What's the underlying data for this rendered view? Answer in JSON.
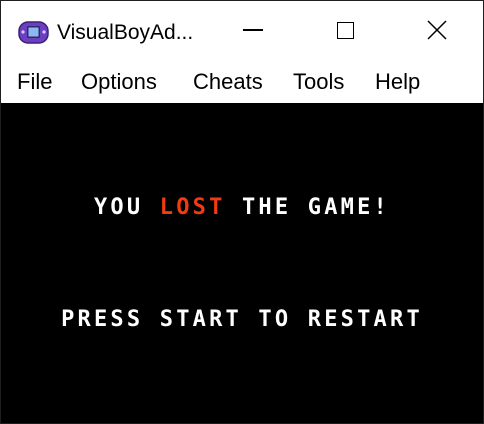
{
  "window": {
    "title": "VisualBoyAd...",
    "icon": "gameboy-advance-icon",
    "controls": {
      "minimize": "minimize-icon",
      "maximize": "maximize-icon",
      "close": "close-icon"
    }
  },
  "menu": {
    "items": [
      {
        "label": "File"
      },
      {
        "label": "Options"
      },
      {
        "label": "Cheats"
      },
      {
        "label": "Tools"
      },
      {
        "label": "Help"
      }
    ]
  },
  "game": {
    "message_prefix": "YOU ",
    "message_highlight": "LOST",
    "message_suffix": " THE GAME!",
    "prompt": "PRESS START TO RESTART"
  },
  "colors": {
    "screen_background": "#000000",
    "text": "#ffffff",
    "highlight": "#f23b12"
  }
}
